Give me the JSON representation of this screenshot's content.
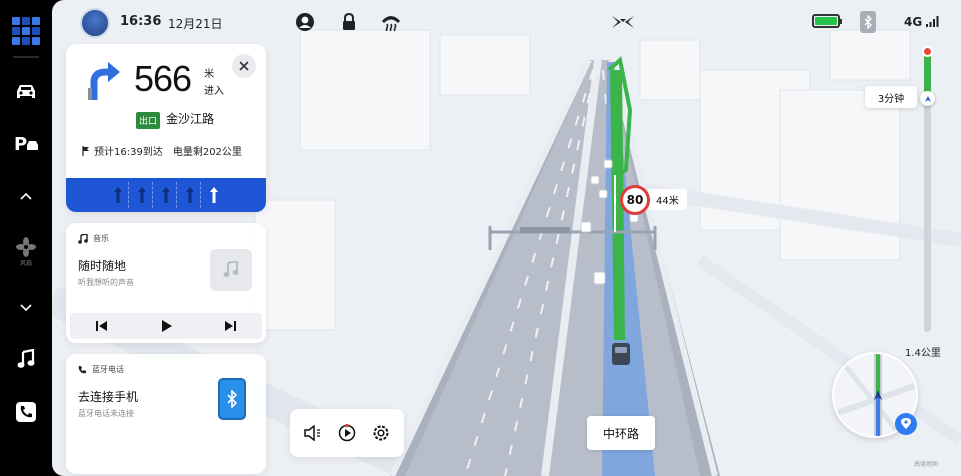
{
  "status_bar": {
    "time": "16:36",
    "date": "12月21日",
    "network": "4G",
    "battery_level": 1.0,
    "icons": [
      "avatar",
      "profile-icon",
      "lock-icon",
      "defrost-icon",
      "brand-logo-icon",
      "battery-icon",
      "bluetooth-icon",
      "signal-icon"
    ]
  },
  "dock": {
    "fan_label": "风扇",
    "items": [
      "car-icon",
      "parking-icon",
      "chevron-up-icon",
      "fan-icon",
      "chevron-down-icon",
      "music-note-icon",
      "phone-icon"
    ]
  },
  "navigation": {
    "turn_direction": "slight-right",
    "distance": "566",
    "distance_unit": "米",
    "distance_action": "进入",
    "exit_badge": "出口",
    "next_road": "金沙江路",
    "eta_text": "预计16:39到达",
    "battery_range": "电量剩202公里",
    "lanes": [
      "straight",
      "straight",
      "straight",
      "straight",
      "straight-highlight"
    ]
  },
  "music": {
    "header": "音乐",
    "title": "随时随地",
    "subtitle": "听我想听的声音",
    "controls": [
      "previous-icon",
      "play-icon",
      "next-icon"
    ]
  },
  "phone": {
    "header": "蓝牙电话",
    "title": "去连接手机",
    "subtitle": "蓝牙电话未连接"
  },
  "media_bar": [
    "volume-icon",
    "route-preview-icon",
    "settings-icon"
  ],
  "speed_camera": {
    "speed_limit": "80",
    "distance": "44米"
  },
  "current_road": "中环路",
  "route_progress": {
    "remaining_time": "3分钟",
    "remaining_distance": "1.4公里",
    "progress_fraction": 0.15
  },
  "watermark": "高德地图",
  "colors": {
    "accent_blue": "#1e56d6",
    "route_green": "#3bb54a",
    "alert_red": "#e03b3b",
    "exit_green": "#2e8b3b"
  }
}
